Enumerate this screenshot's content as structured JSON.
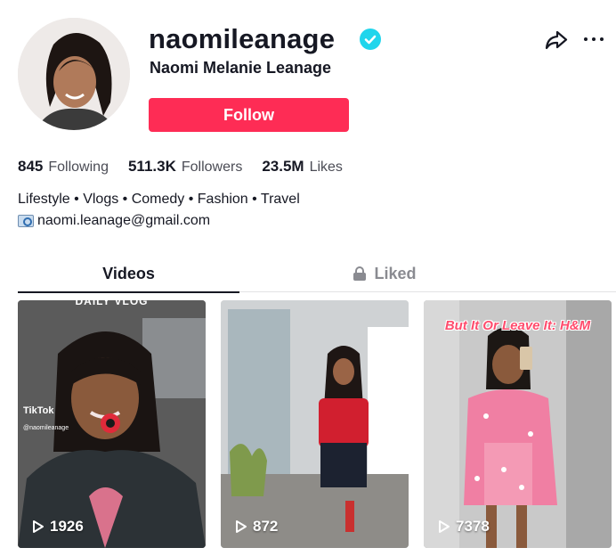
{
  "profile": {
    "username": "naomileanage",
    "nickname": "Naomi Melanie Leanage",
    "follow_label": "Follow"
  },
  "stats": [
    {
      "value": "845",
      "label": "Following"
    },
    {
      "value": "511.3K",
      "label": "Followers"
    },
    {
      "value": "23.5M",
      "label": "Likes"
    }
  ],
  "bio": {
    "line1": "Lifestyle • Vlogs • Comedy • Fashion • Travel",
    "email": "naomi.leanage@gmail.com"
  },
  "tabs": {
    "videos": "Videos",
    "liked": "Liked"
  },
  "videos": [
    {
      "views": "1926",
      "overlay": "DAILY VLOG",
      "logo_text": "TikTok",
      "handle": "@naomileanage"
    },
    {
      "views": "872"
    },
    {
      "views": "7378",
      "overlay": "But It Or Leave It: H&M"
    }
  ],
  "colors": {
    "follow_button": "#fe2c55",
    "verified_badge": "#20d5ec",
    "text_primary": "#161823",
    "text_muted": "#8a8b91"
  },
  "icons": [
    "verified-badge-icon",
    "share-icon",
    "more-icon",
    "email-icon",
    "lock-icon",
    "play-icon"
  ]
}
